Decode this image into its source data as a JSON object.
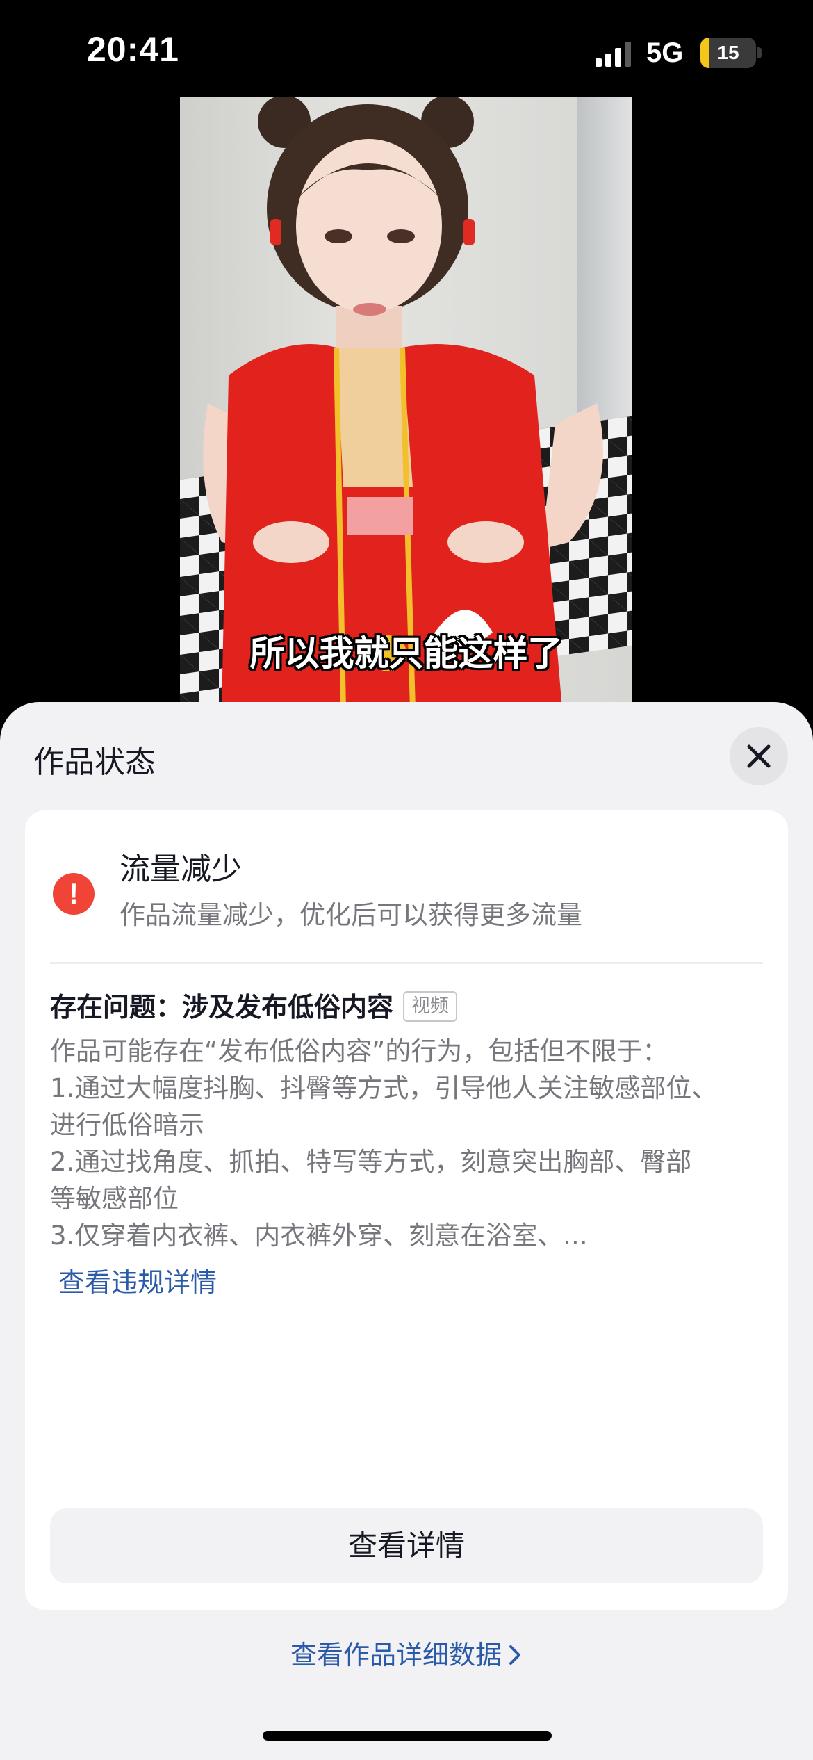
{
  "status_bar": {
    "time": "20:41",
    "network": "5G",
    "battery_level": "15",
    "battery_fraction": 0.15,
    "signal_bars_active": 3,
    "signal_bars_total": 4
  },
  "video": {
    "subtitle": "所以我就只能这样了"
  },
  "sheet": {
    "title": "作品状态",
    "close_icon": "close-icon"
  },
  "status": {
    "icon": "exclamation-icon",
    "icon_glyph": "!",
    "heading": "流量减少",
    "description": "作品流量减少，优化后可以获得更多流量",
    "accent_color": "#f04436"
  },
  "issue": {
    "title": "存在问题：涉及发布低俗内容",
    "tag": "视频",
    "lines": [
      "作品可能存在“发布低俗内容”的行为，包括但不限于：",
      "1.通过大幅度抖胸、抖臀等方式，引导他人关注敏感部位、",
      "进行低俗暗示",
      "2.通过找角度、抓拍、特写等方式，刻意突出胸部、臀部",
      "等敏感部位",
      "3.仅穿着内衣裤、内衣裤外穿、刻意在浴室、..."
    ],
    "link_label": "查看违规详情",
    "link_color": "#2b5ba8"
  },
  "actions": {
    "detail_button_label": "查看详情",
    "data_link_label": "查看作品详细数据"
  }
}
